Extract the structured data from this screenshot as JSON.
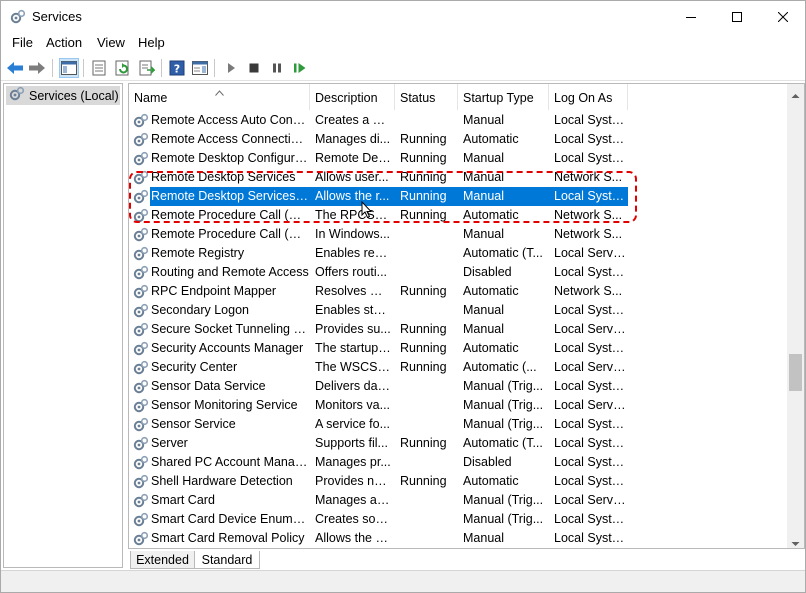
{
  "window": {
    "title": "Services",
    "app_icon": "gears-icon"
  },
  "menu": [
    "File",
    "Action",
    "View",
    "Help"
  ],
  "toolbar": {
    "icons": [
      "back-arrow-icon",
      "forward-arrow-icon",
      "show-hide-console-tree-icon",
      "properties-icon",
      "refresh-icon",
      "export-list-icon",
      "help-icon",
      "show-hide-action-pane-icon",
      "start-service-icon",
      "stop-service-icon",
      "pause-service-icon",
      "restart-service-icon"
    ]
  },
  "tree": {
    "item": "Services (Local)"
  },
  "columns": {
    "name": "Name",
    "description": "Description",
    "status": "Status",
    "startup": "Startup Type",
    "logon": "Log On As"
  },
  "rows": [
    {
      "name": "Remote Access Auto Conne...",
      "desc": "Creates a co...",
      "status": "",
      "startup": "Manual",
      "logon": "Local Syste..."
    },
    {
      "name": "Remote Access Connection...",
      "desc": "Manages di...",
      "status": "Running",
      "startup": "Automatic",
      "logon": "Local Syste..."
    },
    {
      "name": "Remote Desktop Configurat...",
      "desc": "Remote Des...",
      "status": "Running",
      "startup": "Manual",
      "logon": "Local Syste..."
    },
    {
      "name": "Remote Desktop Services",
      "desc": "Allows user...",
      "status": "Running",
      "startup": "Manual",
      "logon": "Network S..."
    },
    {
      "name": "Remote Desktop Services U...",
      "desc": "Allows the r...",
      "status": "Running",
      "startup": "Manual",
      "logon": "Local Syste...",
      "selected": true
    },
    {
      "name": "Remote Procedure Call (RPC)",
      "desc": "The RPCSS s...",
      "status": "Running",
      "startup": "Automatic",
      "logon": "Network S..."
    },
    {
      "name": "Remote Procedure Call (RP...",
      "desc": "In Windows...",
      "status": "",
      "startup": "Manual",
      "logon": "Network S..."
    },
    {
      "name": "Remote Registry",
      "desc": "Enables rem...",
      "status": "",
      "startup": "Automatic (T...",
      "logon": "Local Service"
    },
    {
      "name": "Routing and Remote Access",
      "desc": "Offers routi...",
      "status": "",
      "startup": "Disabled",
      "logon": "Local Syste..."
    },
    {
      "name": "RPC Endpoint Mapper",
      "desc": "Resolves RP...",
      "status": "Running",
      "startup": "Automatic",
      "logon": "Network S..."
    },
    {
      "name": "Secondary Logon",
      "desc": "Enables star...",
      "status": "",
      "startup": "Manual",
      "logon": "Local Syste..."
    },
    {
      "name": "Secure Socket Tunneling Pr...",
      "desc": "Provides su...",
      "status": "Running",
      "startup": "Manual",
      "logon": "Local Service"
    },
    {
      "name": "Security Accounts Manager",
      "desc": "The startup ...",
      "status": "Running",
      "startup": "Automatic",
      "logon": "Local Syste..."
    },
    {
      "name": "Security Center",
      "desc": "The WSCSV...",
      "status": "Running",
      "startup": "Automatic (...",
      "logon": "Local Service"
    },
    {
      "name": "Sensor Data Service",
      "desc": "Delivers dat...",
      "status": "",
      "startup": "Manual (Trig...",
      "logon": "Local Syste..."
    },
    {
      "name": "Sensor Monitoring Service",
      "desc": "Monitors va...",
      "status": "",
      "startup": "Manual (Trig...",
      "logon": "Local Service"
    },
    {
      "name": "Sensor Service",
      "desc": "A service fo...",
      "status": "",
      "startup": "Manual (Trig...",
      "logon": "Local Syste..."
    },
    {
      "name": "Server",
      "desc": "Supports fil...",
      "status": "Running",
      "startup": "Automatic (T...",
      "logon": "Local Syste..."
    },
    {
      "name": "Shared PC Account Manager",
      "desc": "Manages pr...",
      "status": "",
      "startup": "Disabled",
      "logon": "Local Syste..."
    },
    {
      "name": "Shell Hardware Detection",
      "desc": "Provides no...",
      "status": "Running",
      "startup": "Automatic",
      "logon": "Local Syste..."
    },
    {
      "name": "Smart Card",
      "desc": "Manages ac...",
      "status": "",
      "startup": "Manual (Trig...",
      "logon": "Local Service"
    },
    {
      "name": "Smart Card Device Enumera...",
      "desc": "Creates soft...",
      "status": "",
      "startup": "Manual (Trig...",
      "logon": "Local Syste..."
    },
    {
      "name": "Smart Card Removal Policy",
      "desc": "Allows the s...",
      "status": "",
      "startup": "Manual",
      "logon": "Local Syste..."
    }
  ],
  "tabs": {
    "extended": "Extended",
    "standard": "Standard"
  },
  "colors": {
    "selection": "#0078d7",
    "highlight": "#e30000"
  }
}
